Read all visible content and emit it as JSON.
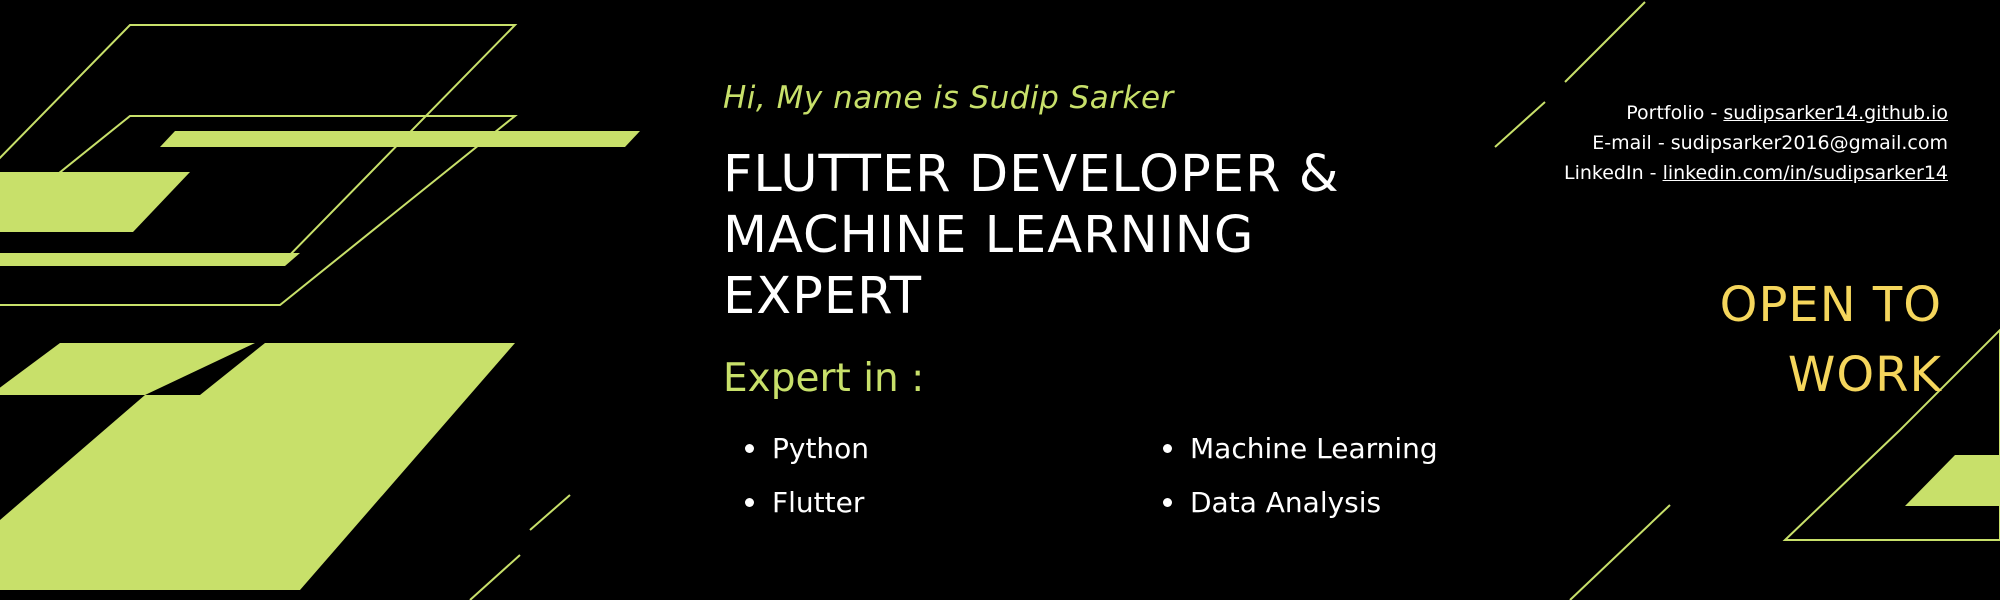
{
  "colors": {
    "background": "#000000",
    "accent_green": "#c8e06a",
    "accent_yellow": "#f5d65c",
    "text": "#ffffff"
  },
  "hero": {
    "greeting": "Hi, My name is Sudip Sarker",
    "title_line_1": "FLUTTER DEVELOPER &",
    "title_line_2": "MACHINE LEARNING",
    "title_line_3": "EXPERT"
  },
  "expertise": {
    "heading": "Expert in :",
    "skills": [
      "Python",
      "Flutter",
      "Machine Learning",
      "Data Analysis"
    ]
  },
  "contacts": {
    "portfolio_label": "Portfolio - ",
    "portfolio_value": "sudipsarker14.github.io",
    "email_label": "E-mail - ",
    "email_value": "sudipsarker2016@gmail.com",
    "linkedin_label": "LinkedIn - ",
    "linkedin_value": "linkedin.com/in/sudipsarker14"
  },
  "status": {
    "line_1": "OPEN TO",
    "line_2": "WORK"
  }
}
